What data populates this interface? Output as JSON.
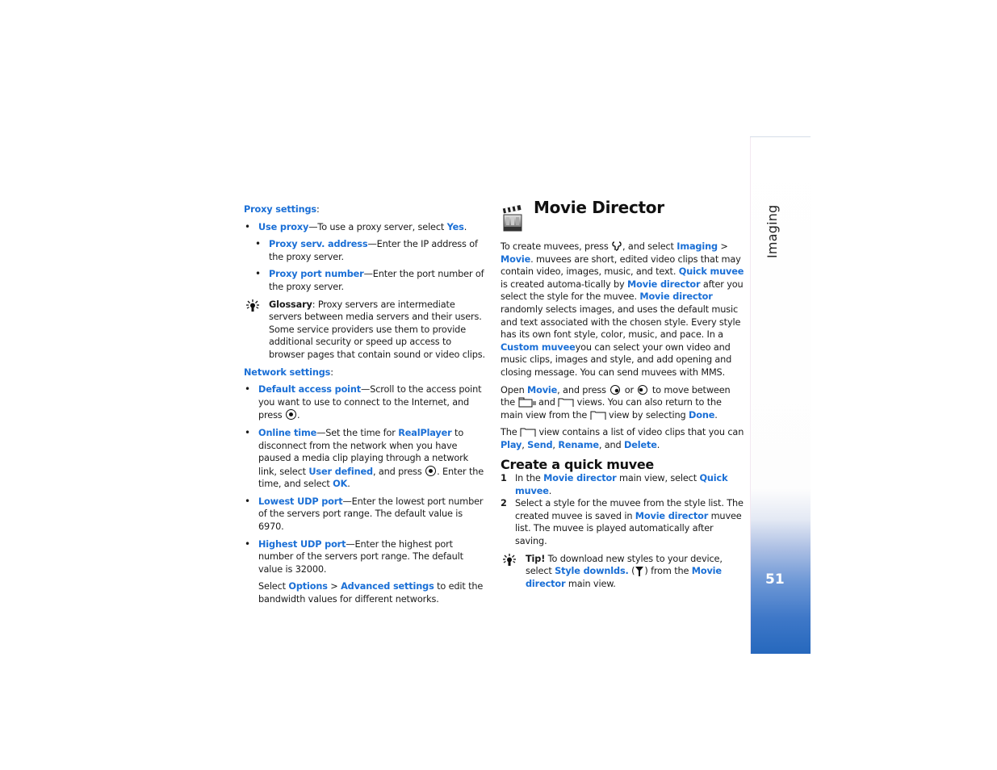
{
  "left": {
    "proxy_label": "Proxy settings",
    "proxy_items": [
      {
        "term": "Use proxy",
        "text_a": "—To use a proxy server, select ",
        "link": "Yes",
        "text_b": "."
      },
      {
        "term": "Proxy serv. address",
        "text_a": "—Enter the IP address of the proxy server."
      },
      {
        "term": "Proxy port number",
        "text_a": "—Enter the port number of the proxy server."
      }
    ],
    "glossary": {
      "label": "Glossary",
      "text": ": Proxy servers are intermediate servers between media servers and their users. Some service providers use them to provide additional security or speed up access to browser pages that contain sound or video clips."
    },
    "network_label": "Network settings",
    "network_items": [
      {
        "term": "Default access point",
        "text_a": "—Scroll to the access point you want to use to connect to the Internet, and press ",
        "text_b": "."
      },
      {
        "term": "Online time",
        "text_a": "—Set the time for ",
        "link1": "RealPlayer",
        "text_b": " to disconnect from the network when you have paused a media clip playing through a network link, select ",
        "link2": "User defined",
        "text_c": ", and press ",
        "text_d": ". Enter the time, and select ",
        "link3": "OK",
        "text_e": "."
      },
      {
        "term": "Lowest UDP port",
        "text_a": "—Enter the lowest port number of the servers port range. The  default value is 6970."
      },
      {
        "term": "Highest UDP port",
        "text_a": "—Enter the highest port number of the servers port range. The  default value is 32000."
      }
    ],
    "advanced": {
      "t1": "Select ",
      "l1": "Options",
      "t2": " > ",
      "l2": "Advanced settings",
      "t3": " to edit the bandwidth values for different networks."
    }
  },
  "right": {
    "title": "Movie Director",
    "intro": {
      "t1": "To create muvees, press ",
      "t2": ", and select ",
      "l1": "Imaging",
      "t3": " > ",
      "l2": "Movie",
      "t4": ". muvees are short, edited video clips that may contain video, images, music, and text. ",
      "l3": "Quick muvee",
      "t5": " is created automa-tically by ",
      "l4": "Movie director",
      "t6": " after you select the style for the muvee. ",
      "l5": "Movie director",
      "t7": " randomly selects  images, and uses the default music and text associated with the chosen style. Every style has its own font style, color, music, and pace. In a ",
      "l6": "Custom muvee",
      "t8": "you can select your own video and music clips, images and style, and add opening and closing message. You can send muvees with MMS."
    },
    "open": {
      "t1": "Open ",
      "l1": "Movie",
      "t2": ", and press ",
      "t3": " or ",
      "t4": " to move between the ",
      "t5": " and ",
      "t6": " views. You can also return to the main view from the ",
      "t7": " view by selecting ",
      "l2": "Done",
      "t8": "."
    },
    "view": {
      "t1": "The ",
      "t2": " view contains a list of video clips that you can ",
      "l1": "Play",
      "s1": ", ",
      "l2": "Send",
      "s2": ", ",
      "l3": "Rename",
      "s3": ", and ",
      "l4": "Delete",
      "s4": "."
    },
    "subheading": "Create a quick muvee",
    "steps": [
      {
        "num": "1",
        "t1": "In the ",
        "l1": "Movie director",
        "t2": " main view, select ",
        "l2": "Quick muvee",
        "t3": "."
      },
      {
        "num": "2",
        "t1": "Select a style for the muvee from the style list. The created muvee is saved in ",
        "l1": "Movie director",
        "t2": " muvee list. The muvee is played automatically after saving."
      }
    ],
    "tip": {
      "label": "Tip!",
      "t1": " To download new styles to your device, select ",
      "l1": "Style downlds.",
      "t2": " (",
      "t3": ") from the ",
      "l2": "Movie director",
      "t4": " main view."
    }
  },
  "tab": {
    "section": "Imaging",
    "page_number": "51"
  },
  "colors": {
    "link": "#1a6fd6",
    "tab_bottom": "#2668bd"
  },
  "icons": {
    "heading": "clapperboard-icon",
    "note": "lightbulb-icon",
    "select_key": "joystick-press-icon",
    "menu_key": "menu-key-icon",
    "scroll_left": "joystick-left-icon",
    "scroll_right": "joystick-right-icon",
    "folder": "folder-icon",
    "download": "antenna-icon"
  }
}
